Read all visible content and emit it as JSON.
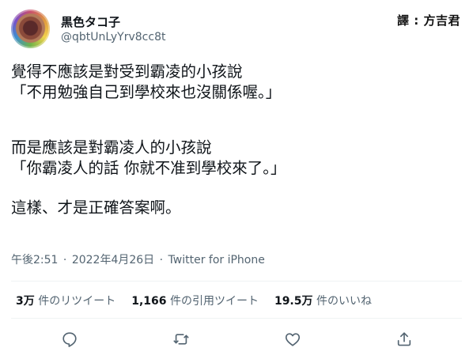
{
  "header": {
    "display_name": "黒色タコ子",
    "handle": "@qbtUnLyYrv8cc8t",
    "watermark": "譯 : 方吉君"
  },
  "tweet": {
    "lines_para1": [
      "覺得不應該是對受到霸凌的小孩說",
      "「不用勉強自己到學校來也沒關係喔。」"
    ],
    "lines_para2": [
      "而是應該是對霸凌人的小孩說",
      "「你霸凌人的話 你就不准到學校來了。」"
    ],
    "lines_para3": [
      "這樣、才是正確答案啊。"
    ]
  },
  "meta": {
    "time": "午後2:51",
    "separator": "·",
    "date": "2022年4月26日",
    "source": "Twitter for iPhone"
  },
  "stats": {
    "retweets_count": "3万",
    "retweets_label": "件のリツイート",
    "quotes_count": "1,166",
    "quotes_label": "件の引用ツイート",
    "likes_count": "19.5万",
    "likes_label": "件のいいね"
  },
  "icons": {
    "reply": "reply-icon",
    "retweet": "retweet-icon",
    "like": "heart-icon",
    "share": "share-icon"
  }
}
